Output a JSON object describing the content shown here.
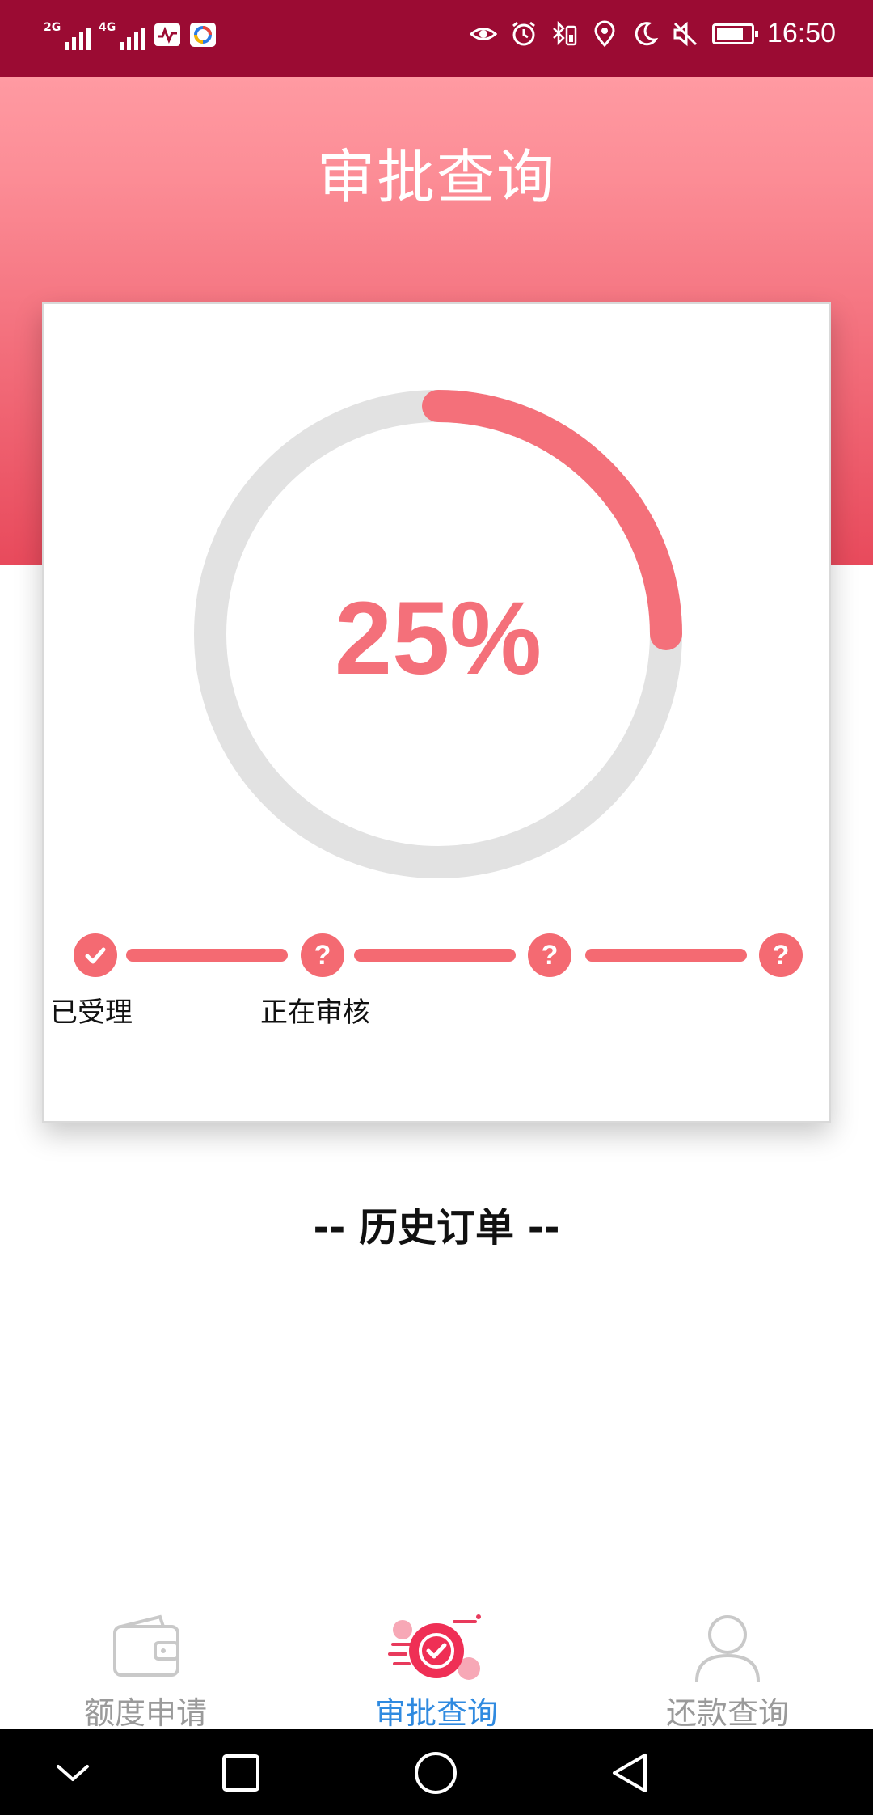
{
  "status_bar": {
    "network_1": "2G",
    "network_2": "4G",
    "time": "16:50"
  },
  "header": {
    "title": "审批查询"
  },
  "progress": {
    "percent_label": "25%",
    "value": 0.25,
    "accent_color": "#f46a72",
    "track_color": "#e2e2e2",
    "steps": [
      {
        "label": "已受理",
        "icon": "check-icon"
      },
      {
        "label": "正在审核",
        "icon": "question-icon"
      },
      {
        "label": "",
        "icon": "question-icon"
      },
      {
        "label": "",
        "icon": "question-icon"
      }
    ]
  },
  "history": {
    "title": "-- 历史订单 --"
  },
  "tabbar": {
    "items": [
      {
        "label": "额度申请",
        "icon": "wallet-icon",
        "active": false
      },
      {
        "label": "审批查询",
        "icon": "approval-check-icon",
        "active": true
      },
      {
        "label": "还款查询",
        "icon": "user-icon",
        "active": false
      }
    ],
    "active_color": "#2f8ae0",
    "inactive_color": "#9a9a9a"
  },
  "system_nav": [
    "chevron-down-icon",
    "recents-square-icon",
    "home-circle-icon",
    "back-triangle-icon"
  ]
}
